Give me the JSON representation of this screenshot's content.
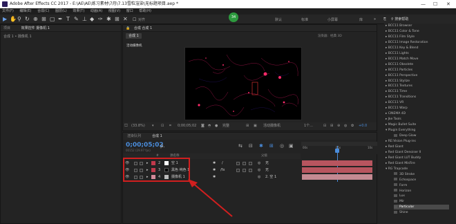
{
  "window": {
    "title": "Adobe After Effects CC 2017 - E:\\AE\\AE\\练习素材\\7月\\7.13雪粒渲染\\无标题项目.aep *",
    "controls": [
      "—",
      "☐",
      "✕"
    ]
  },
  "menu": [
    "文件(F)",
    "编辑(E)",
    "合成(C)",
    "图层(L)",
    "效果(T)",
    "动画(A)",
    "视图(V)",
    "窗口",
    "帮助(H)"
  ],
  "toolbar": {
    "snap_label": "对齐",
    "workspaces": [
      "默认",
      "标准",
      "小屏幕",
      "库"
    ],
    "badge": "34",
    "search_placeholder": "搜索帮助"
  },
  "left_panel": {
    "tabs": [
      "项目",
      "效果控件 摄像机 1"
    ],
    "breadcrumb": "合成 1 • 摄像机 1"
  },
  "comp_viewer": {
    "header": "合成 合成 1",
    "tab": "合成 1",
    "renderer_label": "渲染器：经典 3D",
    "active_camera": "活动摄像机"
  },
  "viewer_bar": {
    "zoom": "(33.8%)",
    "timecode": "0;00;05;02",
    "quality": "完整",
    "view": "活动摄像机",
    "views": "1个...",
    "exposure": "+0.0"
  },
  "timeline": {
    "tabs": [
      "渲染队列",
      "合成 1"
    ],
    "timecode": "0;00;05;02",
    "fps": "00152 (29.97 fps)",
    "search_placeholder": "ρ.",
    "columns": {
      "num": "#",
      "name": "源名称",
      "parent": "父级"
    },
    "layers": [
      {
        "num": "2",
        "name": "空 1",
        "color": "#ffffff",
        "parent": "无"
      },
      {
        "num": "3",
        "name": "黑色 纯色 1",
        "color": "#000000",
        "parent": "无"
      },
      {
        "num": "4",
        "name": "摄像机 1",
        "color": "#bbbbbb",
        "parent": "2. 空 1"
      }
    ],
    "ruler_labels": [
      "00s",
      "05s",
      "10s"
    ]
  },
  "effects": {
    "items": [
      "BCC11 Browser",
      "BCC11 Color & Tone",
      "BCC11 Film Style",
      "BCC11 Image Restoration",
      "BCC11 Key & Blend",
      "BCC11 Lights",
      "BCC11 Match Move",
      "BCC11 Obsolete",
      "BCC11 Particles",
      "BCC11 Perspective",
      "BCC11 Stylize",
      "BCC11 Textures",
      "BCC11 Time",
      "BCC11 Transitions",
      "BCC11 VR",
      "BCC11 Warp",
      "CINEMA 4D",
      "Jke Tools",
      "Magic Bullet Suite",
      "Plugin Everything",
      "Deep Glow",
      "RE:Vision Plug-ins",
      "Red Giant",
      "Red Giant Denoiser II",
      "Red Giant LUT Buddy",
      "Red Giant MisFire",
      "RG Trapcode",
      "3D Stroke",
      "Echospace",
      "Form",
      "Horizon",
      "Lux",
      "Mir",
      "Particular",
      "Shine"
    ],
    "expanded": [
      "Plugin Everything",
      "RG Trapcode"
    ],
    "children": [
      "Deep Glow",
      "3D Stroke",
      "Echospace",
      "Form",
      "Horizon",
      "Lux",
      "Mir",
      "Particular",
      "Shine"
    ],
    "selected": "Particular"
  },
  "colors": {
    "accent": "#4a8ddc",
    "highlight": "#d21f1f",
    "layer_bar": "#c8656d",
    "particle": "#e0206a"
  }
}
